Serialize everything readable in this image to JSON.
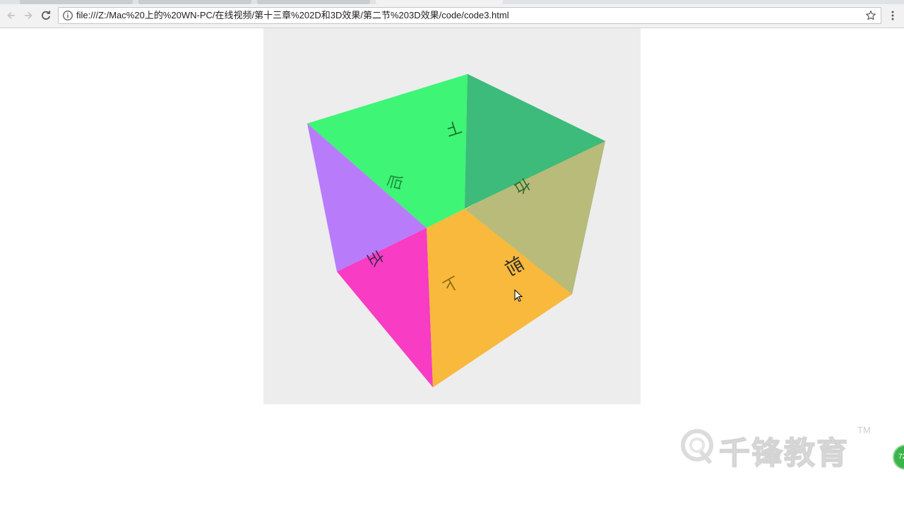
{
  "browser": {
    "address_bar": {
      "url": "file:///Z:/Mac%20上的%20WN-PC/在线视频/第十三章%202D和3D效果/第二节%203D效果/code/code3.html"
    }
  },
  "cube": {
    "faces": [
      {
        "name": "top",
        "color": "#3ef576",
        "label": "上"
      },
      {
        "name": "back-right",
        "color": "#3cbb7a",
        "label": "右"
      },
      {
        "name": "left",
        "color": "#b87cfb",
        "label": "后"
      },
      {
        "name": "front-left",
        "color": "#f83cc3",
        "label": "左"
      },
      {
        "name": "front-right",
        "color": "#f8b93c",
        "label": "下"
      },
      {
        "name": "right",
        "color": "#b8bb7a",
        "label": "前"
      }
    ]
  },
  "watermark": {
    "text": "千锋教育",
    "tm": "TM"
  },
  "floating_badge": {
    "text": "72"
  }
}
